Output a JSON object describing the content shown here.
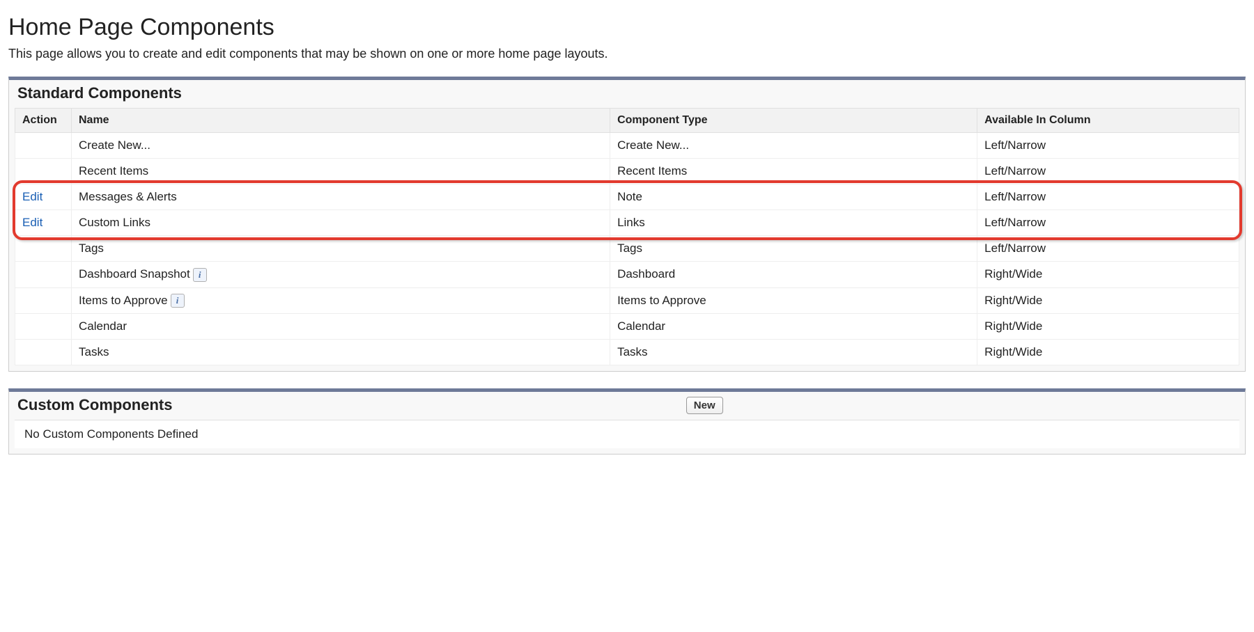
{
  "page": {
    "title": "Home Page Components",
    "description": "This page allows you to create and edit components that may be shown on one or more home page layouts."
  },
  "standard": {
    "title": "Standard Components",
    "columns": {
      "action": "Action",
      "name": "Name",
      "type": "Component Type",
      "available": "Available In Column"
    },
    "edit_label": "Edit",
    "rows": [
      {
        "action": "",
        "name": "Create New...",
        "type": "Create New...",
        "available": "Left/Narrow",
        "info": false
      },
      {
        "action": "",
        "name": "Recent Items",
        "type": "Recent Items",
        "available": "Left/Narrow",
        "info": false
      },
      {
        "action": "Edit",
        "name": "Messages & Alerts",
        "type": "Note",
        "available": "Left/Narrow",
        "info": false
      },
      {
        "action": "Edit",
        "name": "Custom Links",
        "type": "Links",
        "available": "Left/Narrow",
        "info": false
      },
      {
        "action": "",
        "name": "Tags",
        "type": "Tags",
        "available": "Left/Narrow",
        "info": false
      },
      {
        "action": "",
        "name": "Dashboard Snapshot",
        "type": "Dashboard",
        "available": "Right/Wide",
        "info": true
      },
      {
        "action": "",
        "name": "Items to Approve",
        "type": "Items to Approve",
        "available": "Right/Wide",
        "info": true
      },
      {
        "action": "",
        "name": "Calendar",
        "type": "Calendar",
        "available": "Right/Wide",
        "info": false
      },
      {
        "action": "",
        "name": "Tasks",
        "type": "Tasks",
        "available": "Right/Wide",
        "info": false
      }
    ]
  },
  "custom": {
    "title": "Custom Components",
    "new_button_label": "New",
    "empty_message": "No Custom Components Defined"
  }
}
